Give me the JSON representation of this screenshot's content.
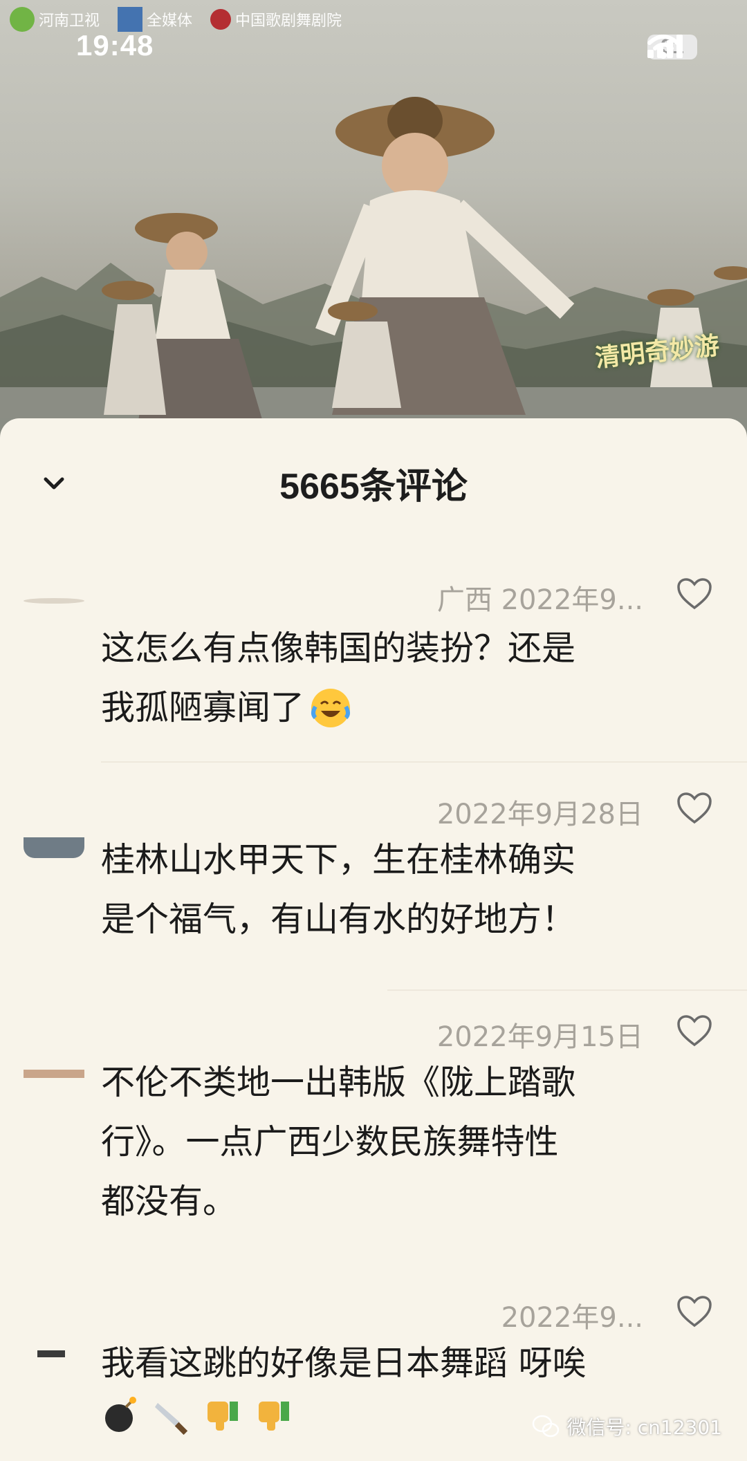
{
  "status": {
    "time": "19:48",
    "battery": "31"
  },
  "hero": {
    "logos": [
      "河南卫视",
      "全媒体",
      "中国歌剧舞剧院"
    ],
    "show_watermark": "清明奇妙游"
  },
  "sheet": {
    "title": "5665条评论"
  },
  "comments": [
    {
      "meta": "广西 2022年9...",
      "text_lines": [
        "这怎么有点像韩国的装扮？还是",
        "我孤陋寡闻了"
      ]
    },
    {
      "meta": "2022年9月28日",
      "text_lines": [
        "桂林山水甲天下，生在桂林确实",
        "是个福气，有山有水的好地方！"
      ]
    },
    {
      "meta": "2022年9月15日",
      "text_lines": [
        "不伦不类地一出韩版《陇上踏歌",
        "行》。一点广西少数民族舞特性",
        "都没有。"
      ]
    },
    {
      "meta": "2022年9...",
      "text_lines": [
        "我看这跳的好像是日本舞蹈 呀唉"
      ]
    }
  ],
  "footer": {
    "wechat_label": "微信号: cn12301"
  },
  "colors": {
    "sheet_bg": "#f8f4ea",
    "meta_gray": "#a7a39b",
    "text": "#1b1b1b"
  }
}
